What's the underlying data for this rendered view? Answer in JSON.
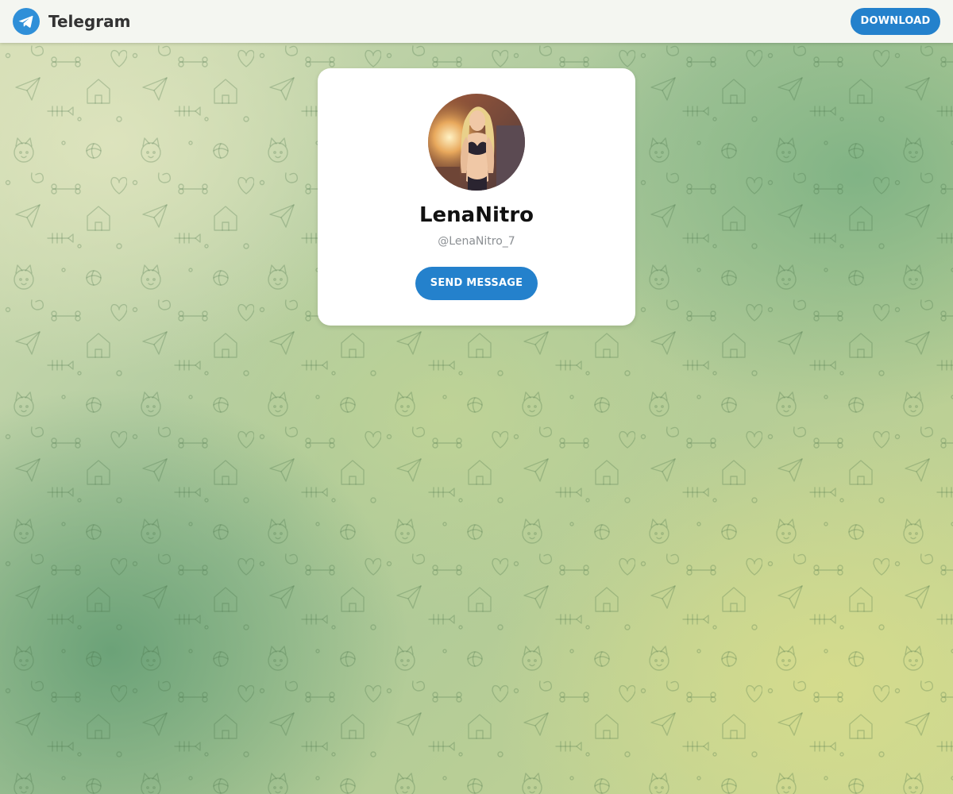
{
  "header": {
    "logo_icon": "telegram-plane-icon",
    "app_name": "Telegram",
    "download_label": "DOWNLOAD"
  },
  "profile": {
    "avatar": "profile-photo",
    "display_name": "LenaNitro",
    "username": "@LenaNitro_7",
    "send_message_label": "SEND MESSAGE"
  },
  "background": {
    "pattern_icon": "doodle-pattern"
  },
  "colors": {
    "accent": "#2481cc",
    "card": "#ffffff",
    "header": "#f4f6f1",
    "name_text": "#111111",
    "username_text": "#8b8f93",
    "bg_green": "#7eb284",
    "bg_yellow": "#d6dc8c"
  }
}
